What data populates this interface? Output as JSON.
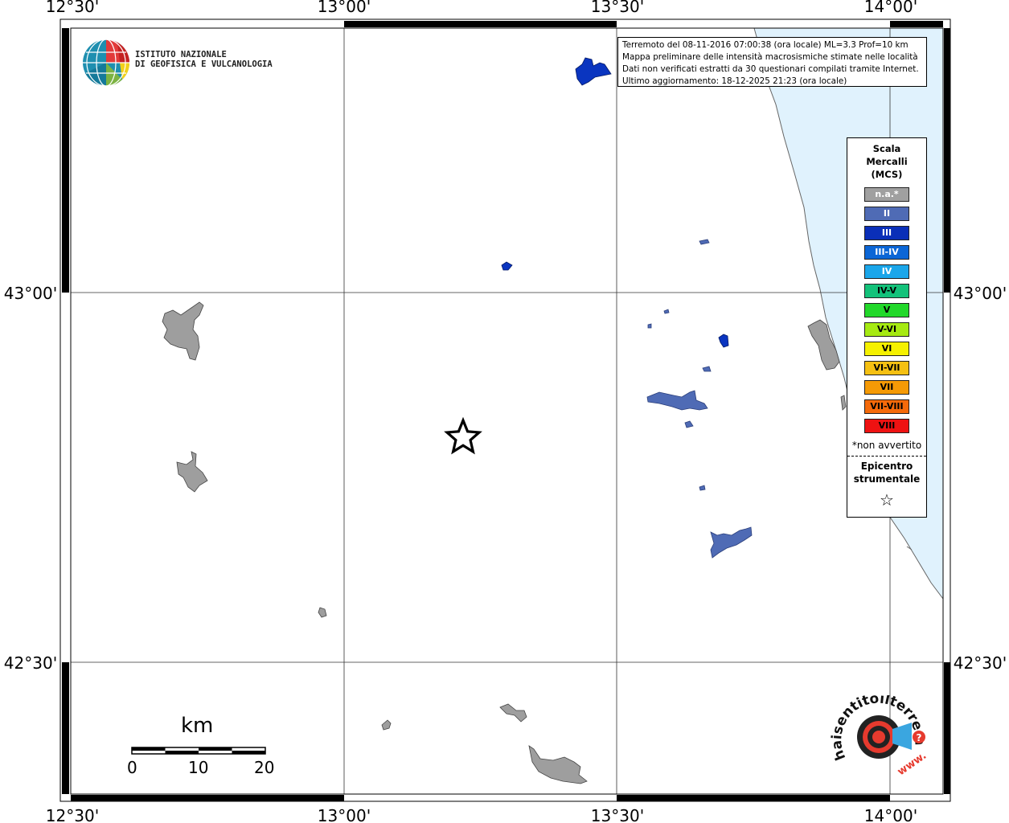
{
  "map": {
    "coords": {
      "lon_top": [
        "12°30'",
        "13°00'",
        "13°30'",
        "14°00'"
      ],
      "lon_bottom": [
        "12°30'",
        "13°00'",
        "13°30'",
        "14°00'"
      ],
      "lat_left": [
        "43°00'",
        "42°30'"
      ],
      "lat_right": [
        "43°00'",
        "42°30'"
      ]
    },
    "colors": {
      "sea": "#e0f2fd",
      "na": "#9e9e9e",
      "ii": "#4f6bb5",
      "iii": "#0a35c0"
    }
  },
  "ingv": {
    "line1": "ISTITUTO NAZIONALE",
    "line2": "DI GEOFISICA E VULCANOLOGIA"
  },
  "info": {
    "line1": "Terremoto del 08-11-2016 07:00:38 (ora locale) ML=3.3 Prof=10 km",
    "line2": "Mappa preliminare delle intensità macrosismiche stimate nelle località",
    "line3": "Dati non verificati estratti da 30 questionari compilati tramite Internet.",
    "line4": "Ultimo aggiornamento: 18-12-2025 21:23 (ora locale)"
  },
  "legend": {
    "title1": "Scala",
    "title2": "Mercalli",
    "title3": "(MCS)",
    "items": [
      {
        "label": "n.a.*",
        "color": "#a0a0a0"
      },
      {
        "label": "II",
        "color": "#4f6bb5"
      },
      {
        "label": "III",
        "color": "#0a2fb8"
      },
      {
        "label": "III-IV",
        "color": "#0b66d6"
      },
      {
        "label": "IV",
        "color": "#1aa6ea"
      },
      {
        "label": "IV-V",
        "color": "#13c27a"
      },
      {
        "label": "V",
        "color": "#22d82a"
      },
      {
        "label": "V-VI",
        "color": "#a6ea12"
      },
      {
        "label": "VI",
        "color": "#f5f100"
      },
      {
        "label": "VI-VII",
        "color": "#f5c012"
      },
      {
        "label": "VII",
        "color": "#f59a06"
      },
      {
        "label": "VII-VIII",
        "color": "#f56a0a"
      },
      {
        "label": "VIII",
        "color": "#ee1212"
      }
    ],
    "note": "*non avvertito",
    "epi1": "Epicentro",
    "epi2": "strumentale",
    "star": "☆"
  },
  "scale": {
    "title": "km",
    "l0": "0",
    "l10": "10",
    "l20": "20"
  },
  "logo": {
    "text": "haisentitoilterremoto.it",
    "www": "www.",
    "qmark": "?"
  }
}
